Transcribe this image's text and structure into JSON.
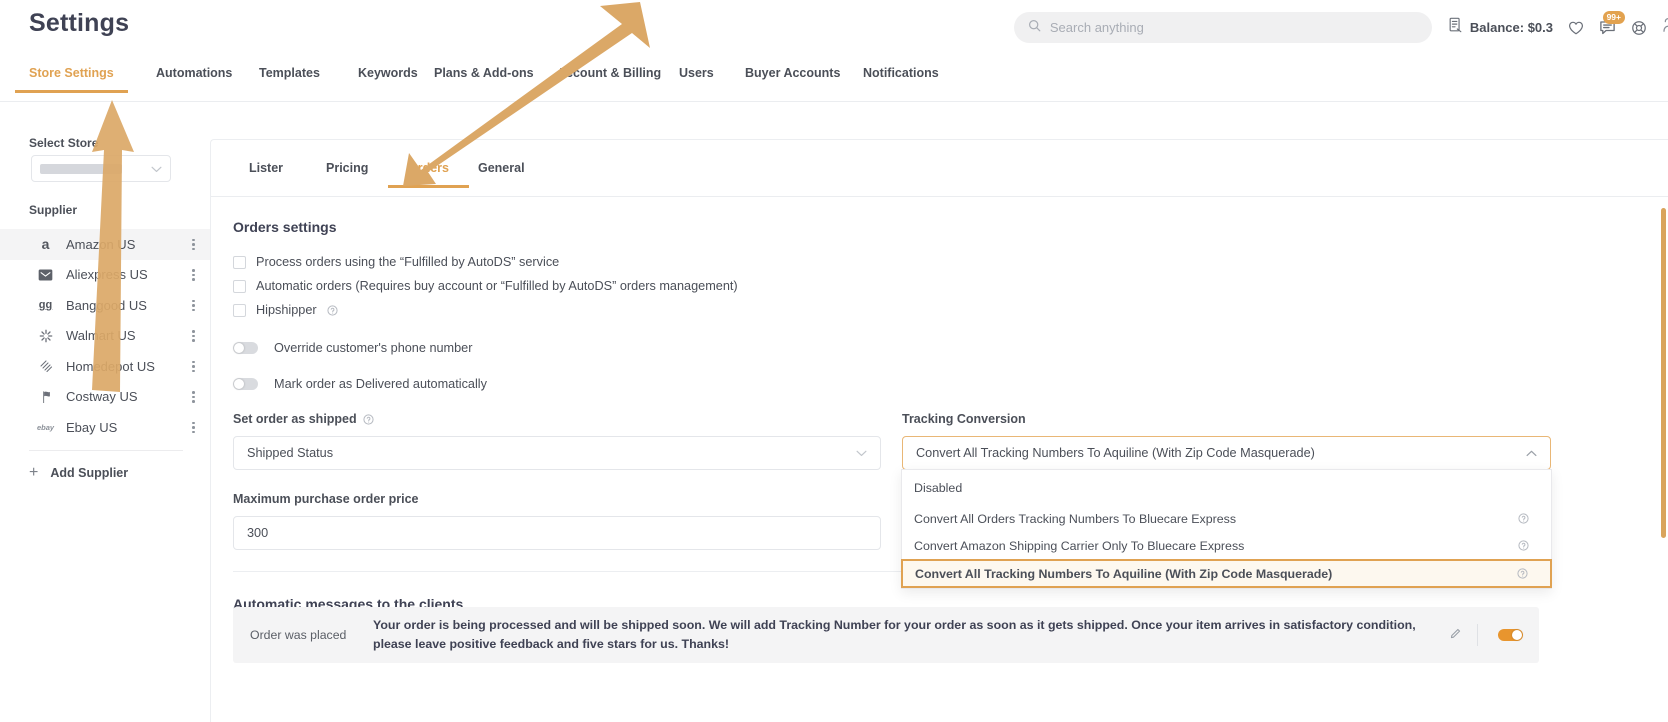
{
  "header": {
    "title": "Settings",
    "search_placeholder": "Search anything",
    "balance_label": "Balance: $0.3",
    "notification_badge": "99+",
    "icons": [
      "search-icon",
      "invoice-icon",
      "heart-icon",
      "chat-icon",
      "lifebuoy-icon",
      "avatar-icon"
    ]
  },
  "main_tabs": [
    {
      "label": "Store Settings",
      "active": true
    },
    {
      "label": "Automations",
      "active": false
    },
    {
      "label": "Templates",
      "active": false
    },
    {
      "label": "Keywords",
      "active": false
    },
    {
      "label": "Plans & Add-ons",
      "active": false
    },
    {
      "label": "Account & Billing",
      "active": false
    },
    {
      "label": "Users",
      "active": false
    },
    {
      "label": "Buyer Accounts",
      "active": false
    },
    {
      "label": "Notifications",
      "active": false
    }
  ],
  "sidebar": {
    "select_store_label": "Select Store",
    "store_value": "",
    "supplier_label": "Supplier",
    "suppliers": [
      {
        "name": "Amazon US",
        "icon": "amazon-icon",
        "glyph": "a",
        "selected": true
      },
      {
        "name": "Aliexpress US",
        "icon": "aliexpress-icon",
        "glyph": "✉",
        "selected": false
      },
      {
        "name": "Banggood US",
        "icon": "banggood-icon",
        "glyph": "gg",
        "selected": false
      },
      {
        "name": "Walmart US",
        "icon": "walmart-icon",
        "glyph": "✳",
        "selected": false
      },
      {
        "name": "Homedepot US",
        "icon": "homedepot-icon",
        "glyph": "▒",
        "selected": false
      },
      {
        "name": "Costway US",
        "icon": "costway-icon",
        "glyph": "⚑",
        "selected": false
      },
      {
        "name": "Ebay US",
        "icon": "ebay-icon",
        "glyph": "ebay",
        "selected": false
      }
    ],
    "add_supplier_label": "Add Supplier"
  },
  "inner_tabs": [
    {
      "label": "Lister",
      "active": false
    },
    {
      "label": "Pricing",
      "active": false
    },
    {
      "label": "Orders",
      "active": true
    },
    {
      "label": "General",
      "active": false
    }
  ],
  "orders": {
    "section_title": "Orders settings",
    "checkboxes": [
      {
        "label": "Process orders using the “Fulfilled by AutoDS” service",
        "checked": false,
        "help": false
      },
      {
        "label": "Automatic orders (Requires buy account or “Fulfilled by AutoDS” orders management)",
        "checked": false,
        "help": false
      },
      {
        "label": "Hipshipper",
        "checked": false,
        "help": true
      }
    ],
    "toggles": [
      {
        "label": "Override customer's phone number",
        "on": false
      },
      {
        "label": "Mark order as Delivered automatically",
        "on": false
      }
    ],
    "set_order_shipped_label": "Set order as shipped",
    "set_order_shipped_value": "Shipped Status",
    "max_price_label": "Maximum purchase order price",
    "max_price_value": "300",
    "tracking_conversion_label": "Tracking Conversion",
    "tracking_conversion_value": "Convert All Tracking Numbers To Aquiline (With Zip Code Masquerade)",
    "tracking_options": [
      {
        "label": "Disabled",
        "help": false,
        "selected": false
      },
      {
        "label": "Convert All Orders Tracking Numbers To Bluecare Express",
        "help": true,
        "selected": false
      },
      {
        "label": "Convert Amazon Shipping Carrier Only To Bluecare Express",
        "help": true,
        "selected": false
      },
      {
        "label": "Convert All Tracking Numbers To Aquiline (With Zip Code Masquerade)",
        "help": true,
        "selected": true
      }
    ]
  },
  "messages": {
    "section_title": "Automatic messages to the clients",
    "rows": [
      {
        "key": "Order was placed",
        "value": "Your order is being processed and will be shipped soon. We will add Tracking Number for your order as soon as it gets shipped. Once your item arrives in satisfactory condition, please leave positive feedback and five stars for us. Thanks!",
        "enabled": true
      }
    ]
  },
  "colors": {
    "accent": "#e0a252",
    "toggle_on": "#e8952e",
    "text": "#4b4f58",
    "annotation_arrow": "#dba867"
  }
}
